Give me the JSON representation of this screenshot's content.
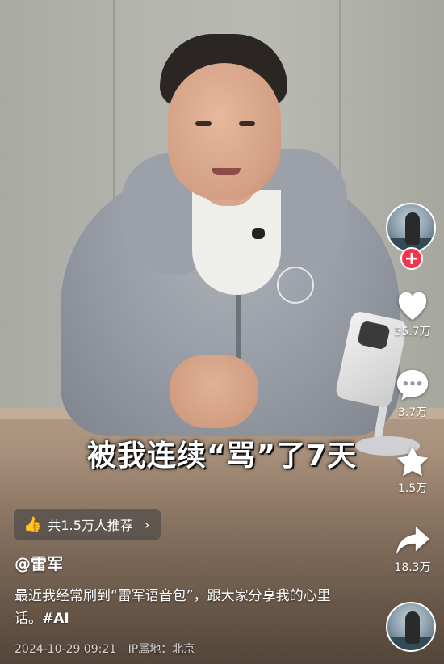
{
  "video": {
    "caption": "被我连续“骂”了7天"
  },
  "sidebar": {
    "follow_symbol": "+",
    "like_count": "55.7万",
    "comment_count": "3.7万",
    "favorite_count": "1.5万",
    "share_count": "18.3万"
  },
  "recommend": {
    "label": "共1.5万人推荐",
    "chevron": "›"
  },
  "post": {
    "author": "@雷军",
    "description": "最近我经常刷到“雷军语音包”，跟大家分享我的心里话。",
    "hashtag": "#AI",
    "timestamp": "2024-10-29 09:21",
    "ip_location": "IP属地：北京"
  },
  "colors": {
    "follow": "#f0364f",
    "text": "#ffffff"
  }
}
